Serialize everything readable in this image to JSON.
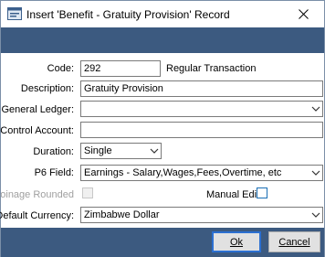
{
  "window": {
    "title": "Insert 'Benefit - Gratuity Provision' Record",
    "icons": {
      "app": "app-window-icon",
      "close": "close-icon"
    }
  },
  "form": {
    "code": {
      "label": "Code:",
      "value": "292",
      "note": "Regular Transaction"
    },
    "description": {
      "label": "Description:",
      "value": "Gratuity Provision"
    },
    "general_ledger": {
      "label": "General Ledger:",
      "value": ""
    },
    "control_account": {
      "label": "Control Account:",
      "value": ""
    },
    "duration": {
      "label": "Duration:",
      "value": "Single"
    },
    "p6_field": {
      "label": "P6 Field:",
      "value": "Earnings - Salary,Wages,Fees,Overtime, etc"
    },
    "coinage_rounded": {
      "label": "Coinage Rounded",
      "checked": false,
      "enabled": false
    },
    "manual_edit": {
      "label": "Manual Edit",
      "checked": false,
      "enabled": true
    },
    "default_currency": {
      "label": "Default Currency:",
      "value": "Zimbabwe Dollar"
    }
  },
  "buttons": {
    "ok": "Ok",
    "cancel": "Cancel"
  },
  "colors": {
    "band": "#3c5a80",
    "focus_border": "#2b6fd1",
    "checkbox_border": "#1a6fb5"
  }
}
